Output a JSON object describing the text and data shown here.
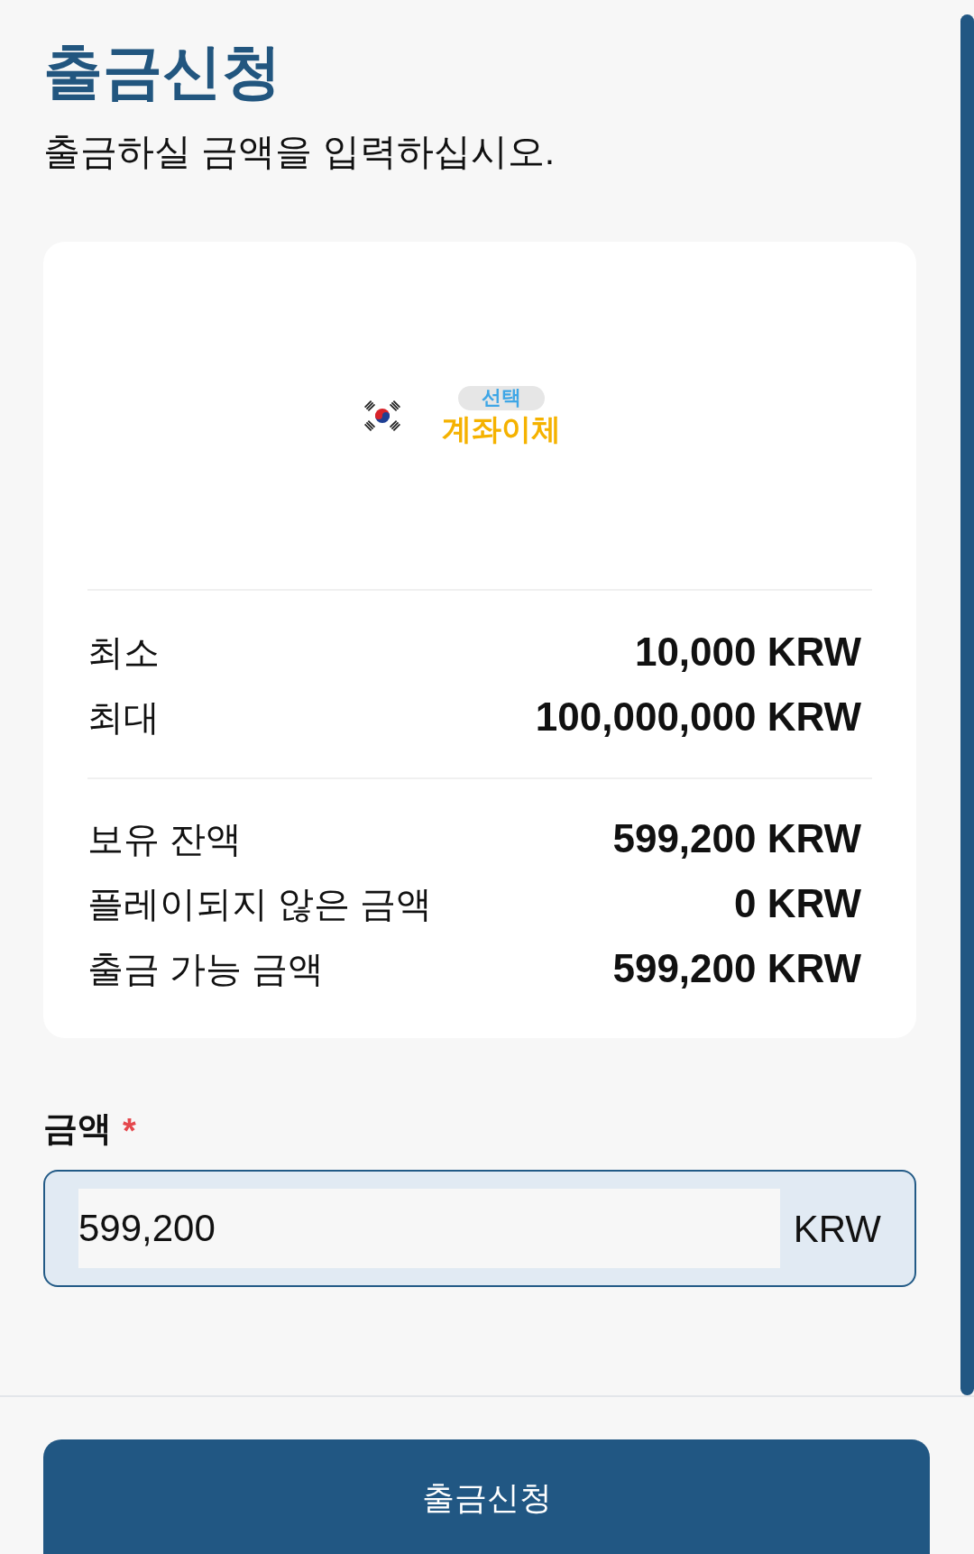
{
  "header": {
    "title": "출금신청",
    "subtitle": "출금하실 금액을 입력하십시오."
  },
  "method": {
    "tag": "선택",
    "name": "계좌이체"
  },
  "limits": [
    {
      "label": "최소",
      "value": "10,000 KRW"
    },
    {
      "label": "최대",
      "value": "100,000,000 KRW"
    }
  ],
  "balances": [
    {
      "label": "보유 잔액",
      "value": "599,200 KRW"
    },
    {
      "label": "플레이되지 않은 금액",
      "value": "0 KRW"
    },
    {
      "label": "출금 가능 금액",
      "value": "599,200 KRW"
    }
  ],
  "amount": {
    "label": "금액",
    "required_mark": "*",
    "value": "599,200",
    "unit": "KRW"
  },
  "submit_button": {
    "label": "출금신청"
  }
}
